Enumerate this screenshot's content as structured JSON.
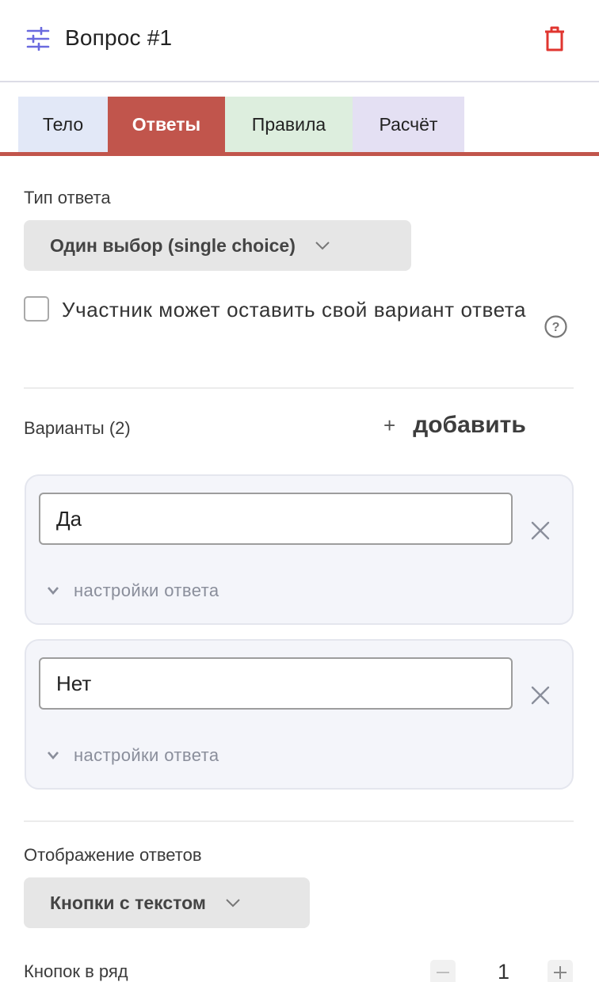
{
  "header": {
    "title": "Вопрос #1",
    "settings_icon": "sliders-icon",
    "delete_icon": "trash-icon"
  },
  "tabs": [
    {
      "label": "Тело",
      "color": "#e2e8f7"
    },
    {
      "label": "Ответы",
      "color": "#c1554c",
      "active": true
    },
    {
      "label": "Правила",
      "color": "#ddeede"
    },
    {
      "label": "Расчёт",
      "color": "#e4e0f3"
    }
  ],
  "answer_type": {
    "label": "Тип ответа",
    "value": "Один выбор (single choice)"
  },
  "custom_option": {
    "checked": false,
    "text": "Участник может оставить свой вариант ответа",
    "help_icon": "help-circle-icon"
  },
  "variants": {
    "label": "Варианты (2)",
    "add_plus": "+",
    "add_label": "добавить",
    "items": [
      {
        "value": "Да",
        "settings_label": "настройки ответа"
      },
      {
        "value": "Нет",
        "settings_label": "настройки ответа"
      }
    ]
  },
  "display": {
    "label": "Отображение ответов",
    "value": "Кнопки с текстом"
  },
  "buttons_per_row": {
    "label": "Кнопок в ряд",
    "minus": "−",
    "value": "1",
    "plus": "+"
  },
  "colors": {
    "accent": "#c1554c",
    "icon_purple": "#6a6adf",
    "delete_red": "#e0352f"
  }
}
